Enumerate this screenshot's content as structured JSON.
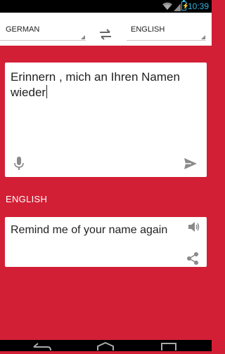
{
  "status": {
    "time": "10:39"
  },
  "languages": {
    "source": "GERMAN",
    "target": "ENGLISH"
  },
  "input": {
    "text": "Erinnern , mich an Ihren Namen wieder"
  },
  "output": {
    "label": "ENGLISH",
    "text": "Remind me of your name again"
  },
  "colors": {
    "accent": "#d21f35",
    "card": "#ffffff",
    "status_text": "#33b5e5"
  },
  "icons": [
    "wifi-icon",
    "signal-icon",
    "battery-icon",
    "swap-icon",
    "microphone-icon",
    "send-icon",
    "speaker-icon",
    "share-icon",
    "back-icon",
    "home-icon",
    "recent-apps-icon"
  ]
}
